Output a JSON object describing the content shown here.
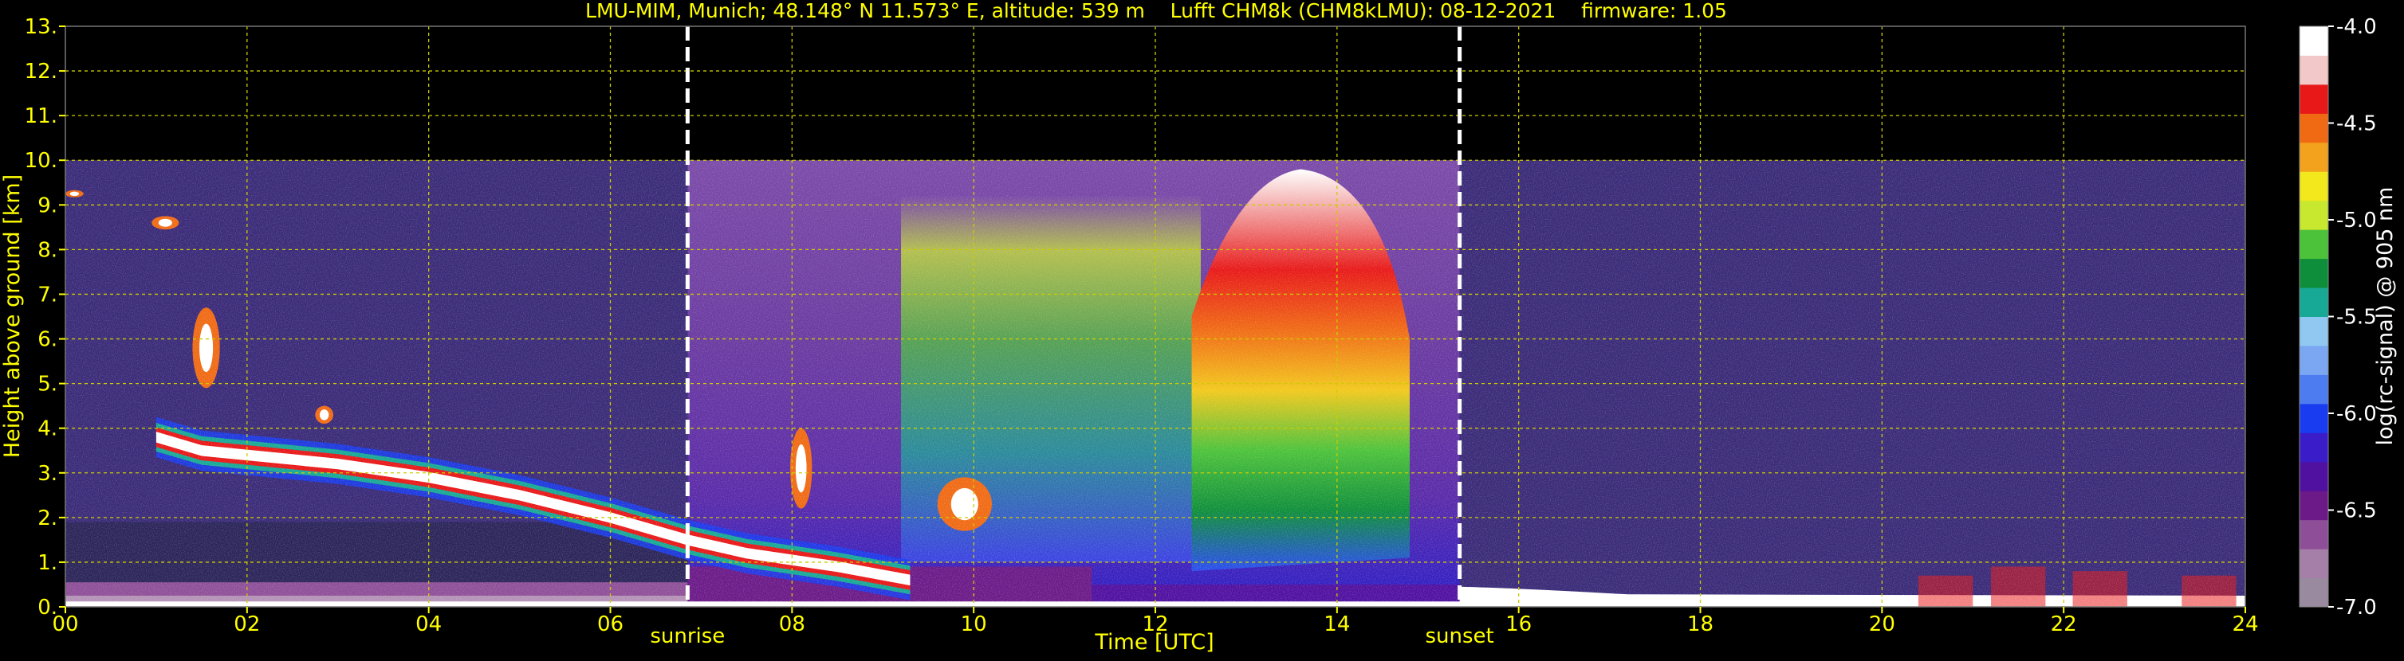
{
  "chart_data": {
    "type": "heatmap",
    "title": "LMU-MIM, Munich; 48.148° N 11.573° E, altitude: 539 m    Lufft CHM8k (CHM8kLMU): 08-12-2021    firmware: 1.05",
    "xlabel": "Time [UTC]",
    "ylabel": "Height above ground [km]",
    "colorbar_label": "log(rc-signal) @ 905 nm",
    "xlim": [
      0,
      24
    ],
    "ylim": [
      0,
      13
    ],
    "x_ticks": [
      "00",
      "02",
      "04",
      "06",
      "08",
      "10",
      "12",
      "14",
      "16",
      "18",
      "20",
      "22",
      "24"
    ],
    "y_ticks": [
      "0.",
      "1.",
      "2.",
      "3.",
      "4.",
      "5.",
      "6.",
      "7.",
      "8.",
      "9.",
      "10.",
      "11.",
      "12.",
      "13."
    ],
    "colorbar_ticks": [
      "-4.0",
      "-4.5",
      "-5.0",
      "-5.5",
      "-6.0",
      "-6.5",
      "-7.0"
    ],
    "colorbar_range": [
      -7.0,
      -4.0
    ],
    "grid": true,
    "annotations": [
      {
        "text": "sunrise",
        "x": 6.85
      },
      {
        "text": "sunset",
        "x": 15.35
      }
    ],
    "data_max_height_km": 10.0,
    "features": [
      {
        "name": "boundary layer aerosol",
        "x_range": [
          0,
          24
        ],
        "height_km": [
          0,
          0.5
        ]
      },
      {
        "name": "descending cloud layer",
        "x_range": [
          1.0,
          9.5
        ],
        "height_km": [
          0.5,
          4.2
        ]
      },
      {
        "name": "dense precipitation signal",
        "x_range": [
          12.5,
          14.8
        ],
        "height_km": [
          0.5,
          9.5
        ]
      },
      {
        "name": "daytime solar background noise",
        "x_range": [
          6.85,
          15.35
        ],
        "height_km": [
          0,
          10
        ]
      }
    ]
  },
  "colors": {
    "background": "#000000",
    "axis_text": "#ffff00",
    "grid": "#cccc00",
    "colormap": [
      "#9a8aa0",
      "#a67fa8",
      "#8e4f98",
      "#6b1a88",
      "#5010a0",
      "#3a1cc8",
      "#1a3cf0",
      "#4c7cf0",
      "#7aa6f2",
      "#90c8f2",
      "#18a896",
      "#0e8e3a",
      "#4cc23a",
      "#c8e830",
      "#f2e81c",
      "#f2a21c",
      "#f06a14",
      "#e81818",
      "#f2c8c8",
      "#ffffff"
    ]
  }
}
